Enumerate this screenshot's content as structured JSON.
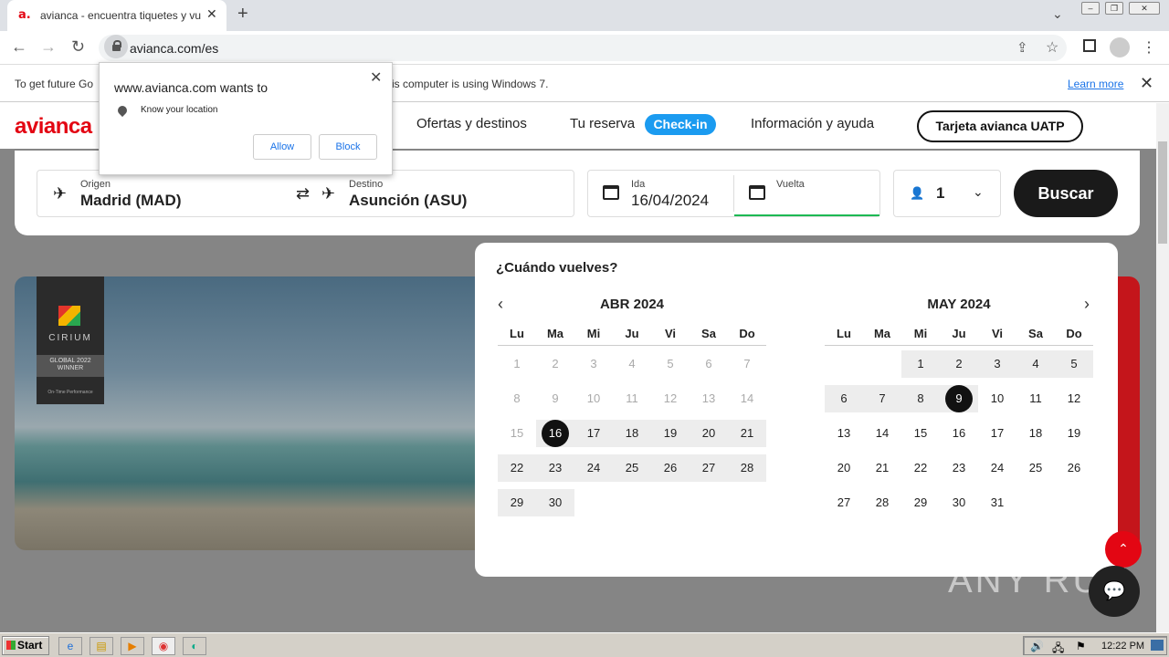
{
  "browser": {
    "tab_title": "avianca - encuentra tiquetes y vuelos",
    "tab_favicon": "a.",
    "new_tab": "+",
    "url": "avianca.com/es",
    "infobar_text_left": "To get future Go",
    "infobar_text_right": "is computer is using Windows 7.",
    "learn_more": "Learn more"
  },
  "permission_popup": {
    "title": "www.avianca.com wants to",
    "permission": "Know your location",
    "allow": "Allow",
    "block": "Block"
  },
  "site": {
    "logo": "avianca",
    "nav": [
      "Ofertas y destinos",
      "Tu reserva",
      "Información y ayuda"
    ],
    "checkin": "Check-in",
    "uatp": "Tarjeta avianca UATP",
    "brand_color": "#e30613"
  },
  "search": {
    "origin_label": "Origen",
    "origin_value": "Madrid (MAD)",
    "dest_label": "Destino",
    "dest_value": "Asunción (ASU)",
    "ida_label": "Ida",
    "ida_value": "16/04/2024",
    "vuelta_label": "Vuelta",
    "passengers": "1",
    "search_button": "Buscar"
  },
  "badge": {
    "name": "CIRIUM",
    "award": "GLOBAL 2022 WINNER",
    "sub": "On-Time Performance"
  },
  "calendar": {
    "question": "¿Cuándo vuelves?",
    "dow": [
      "Lu",
      "Ma",
      "Mi",
      "Ju",
      "Vi",
      "Sa",
      "Do"
    ],
    "months": [
      {
        "title": "ABR 2024",
        "offset": 0,
        "days": 30,
        "past_until": 15,
        "range_from": 16,
        "range_to": 30,
        "selected": 16
      },
      {
        "title": "MAY 2024",
        "offset": 2,
        "days": 31,
        "past_until": 0,
        "range_from": 1,
        "range_to": 9,
        "selected": 9
      }
    ]
  },
  "watermark": "ANY RUN",
  "taskbar": {
    "start": "Start",
    "clock": "12:22 PM"
  }
}
